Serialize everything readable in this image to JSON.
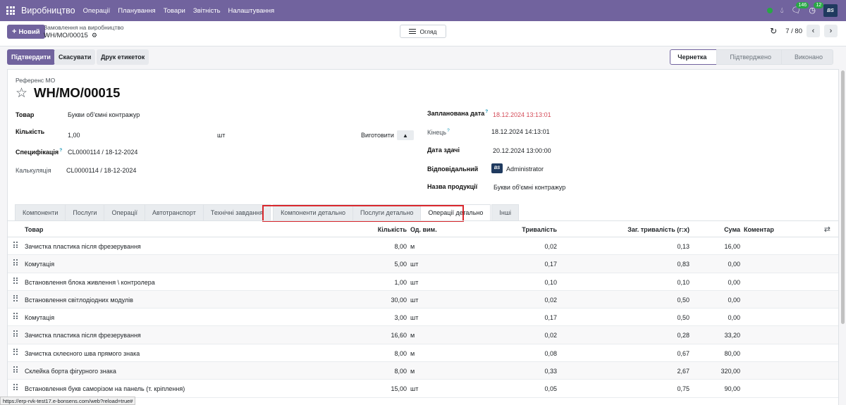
{
  "nav": {
    "brand": "Виробництво",
    "items": [
      "Операції",
      "Планування",
      "Товари",
      "Звітність",
      "Налаштування"
    ],
    "activity_count": "146",
    "clock_count": "12"
  },
  "control": {
    "new_label": "Новий",
    "breadcrumb_parent": "Замовлення на виробництво",
    "breadcrumb_current": "WH/MO/00015",
    "view_label": "Огляд",
    "pager": "7 / 80"
  },
  "statusbar": {
    "confirm": "Підтвердити",
    "cancel": "Скасувати",
    "print_labels": "Друк етикеток",
    "stages": [
      "Чернетка",
      "Підтверджено",
      "Виконано"
    ],
    "active_stage": "Чернетка"
  },
  "form": {
    "ref_label": "Референс МО",
    "title": "WH/MO/00015",
    "product_label": "Товар",
    "product": "Букви об'ємні контражур",
    "qty_label": "Кількість",
    "qty": "1,00",
    "uom": "шт",
    "produce_label": "Виготовити",
    "bom_label": "Специфікація",
    "bom": "CL0000114 / 18-12-2024",
    "calc_label": "Калькуляція",
    "calc": "CL0000114 / 18-12-2024",
    "planned_label": "Запланована дата",
    "planned": "18.12.2024 13:13:01",
    "end_label": "Кінець",
    "end": "18.12.2024 14:13:01",
    "deadline_label": "Дата здачі",
    "deadline": "20.12.2024 13:00:00",
    "responsible_label": "Відповідальний",
    "responsible": "Administrator",
    "product_name_label": "Назва продукції",
    "product_name": "Букви об'ємні контражур",
    "help_mark": "?"
  },
  "tabs": [
    "Компоненти",
    "Послуги",
    "Операції",
    "Автотранспорт",
    "Технічні завдання",
    "Компоненти детально",
    "Послуги детально",
    "Операції детально",
    "Інші"
  ],
  "active_tab": "Операції детально",
  "table": {
    "headers": {
      "product": "Товар",
      "qty": "Кількість",
      "uom": "Од. вим.",
      "duration": "Тривалість",
      "total_duration": "Заг. тривалість (г:х)",
      "sum": "Сума",
      "comment": "Коментар"
    },
    "rows": [
      {
        "product": "Зачистка пластика після фрезерування",
        "qty": "8,00",
        "uom": "м",
        "duration": "0,02",
        "total": "0,13",
        "sum": "16,00"
      },
      {
        "product": "Комутація",
        "qty": "5,00",
        "uom": "шт",
        "duration": "0,17",
        "total": "0,83",
        "sum": "0,00"
      },
      {
        "product": "Встановлення блока живлення \\ контролера",
        "qty": "1,00",
        "uom": "шт",
        "duration": "0,10",
        "total": "0,10",
        "sum": "0,00"
      },
      {
        "product": "Встановлення світлодіодних модулів",
        "qty": "30,00",
        "uom": "шт",
        "duration": "0,02",
        "total": "0,50",
        "sum": "0,00"
      },
      {
        "product": "Комутація",
        "qty": "3,00",
        "uom": "шт",
        "duration": "0,17",
        "total": "0,50",
        "sum": "0,00"
      },
      {
        "product": "Зачистка пластика після фрезерування",
        "qty": "16,60",
        "uom": "м",
        "duration": "0,02",
        "total": "0,28",
        "sum": "33,20"
      },
      {
        "product": "Зачистка склеєного шва прямого знака",
        "qty": "8,00",
        "uom": "м",
        "duration": "0,08",
        "total": "0,67",
        "sum": "80,00"
      },
      {
        "product": "Склейка борта фігурного знака",
        "qty": "8,00",
        "uom": "м",
        "duration": "0,33",
        "total": "2,67",
        "sum": "320,00"
      },
      {
        "product": "Встановлення букв саморізом на панель (т. кріплення)",
        "qty": "15,00",
        "uom": "шт",
        "duration": "0,05",
        "total": "0,75",
        "sum": "90,00"
      }
    ]
  },
  "status_url": "https://erp-rvk-test17.e-bonsens.com/web?reload=true#",
  "colors": {
    "brand": "#71639e",
    "accent_red": "#d44c59",
    "highlight": "#d9282d"
  }
}
